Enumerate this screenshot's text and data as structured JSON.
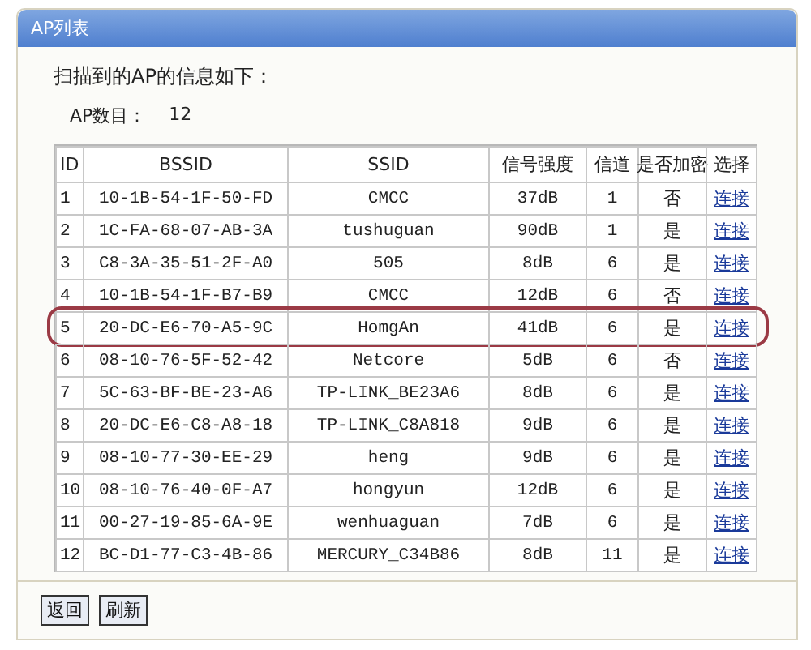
{
  "window": {
    "title": "AP列表"
  },
  "heading": "扫描到的AP的信息如下：",
  "ap_count": {
    "label": "AP数目：",
    "value": "12"
  },
  "table": {
    "columns": [
      "ID",
      "BSSID",
      "SSID",
      "信号强度",
      "信道",
      "是否加密",
      "选择"
    ],
    "rows": [
      {
        "id": "1",
        "bssid": "10-1B-54-1F-50-FD",
        "ssid": "CMCC",
        "signal": "37dB",
        "channel": "1",
        "encrypted": "否",
        "action": "连接",
        "selected": false
      },
      {
        "id": "2",
        "bssid": "1C-FA-68-07-AB-3A",
        "ssid": "tushuguan",
        "signal": "90dB",
        "channel": "1",
        "encrypted": "是",
        "action": "连接",
        "selected": false
      },
      {
        "id": "3",
        "bssid": "C8-3A-35-51-2F-A0",
        "ssid": "505",
        "signal": "8dB",
        "channel": "6",
        "encrypted": "是",
        "action": "连接",
        "selected": false
      },
      {
        "id": "4",
        "bssid": "10-1B-54-1F-B7-B9",
        "ssid": "CMCC",
        "signal": "12dB",
        "channel": "6",
        "encrypted": "否",
        "action": "连接",
        "selected": false
      },
      {
        "id": "5",
        "bssid": "20-DC-E6-70-A5-9C",
        "ssid": "HomgAn",
        "signal": "41dB",
        "channel": "6",
        "encrypted": "是",
        "action": "连接",
        "selected": true
      },
      {
        "id": "6",
        "bssid": "08-10-76-5F-52-42",
        "ssid": "Netcore",
        "signal": "5dB",
        "channel": "6",
        "encrypted": "否",
        "action": "连接",
        "selected": false
      },
      {
        "id": "7",
        "bssid": "5C-63-BF-BE-23-A6",
        "ssid": "TP-LINK_BE23A6",
        "signal": "8dB",
        "channel": "6",
        "encrypted": "是",
        "action": "连接",
        "selected": false
      },
      {
        "id": "8",
        "bssid": "20-DC-E6-C8-A8-18",
        "ssid": "TP-LINK_C8A818",
        "signal": "9dB",
        "channel": "6",
        "encrypted": "是",
        "action": "连接",
        "selected": false
      },
      {
        "id": "9",
        "bssid": "08-10-77-30-EE-29",
        "ssid": "heng",
        "signal": "9dB",
        "channel": "6",
        "encrypted": "是",
        "action": "连接",
        "selected": false
      },
      {
        "id": "10",
        "bssid": "08-10-76-40-0F-A7",
        "ssid": "hongyun",
        "signal": "12dB",
        "channel": "6",
        "encrypted": "是",
        "action": "连接",
        "selected": false
      },
      {
        "id": "11",
        "bssid": "00-27-19-85-6A-9E",
        "ssid": "wenhuaguan",
        "signal": "7dB",
        "channel": "6",
        "encrypted": "是",
        "action": "连接",
        "selected": false
      },
      {
        "id": "12",
        "bssid": "BC-D1-77-C3-4B-86",
        "ssid": "MERCURY_C34B86",
        "signal": "8dB",
        "channel": "11",
        "encrypted": "是",
        "action": "连接",
        "selected": false
      }
    ]
  },
  "buttons": [
    "返回",
    "刷新"
  ]
}
